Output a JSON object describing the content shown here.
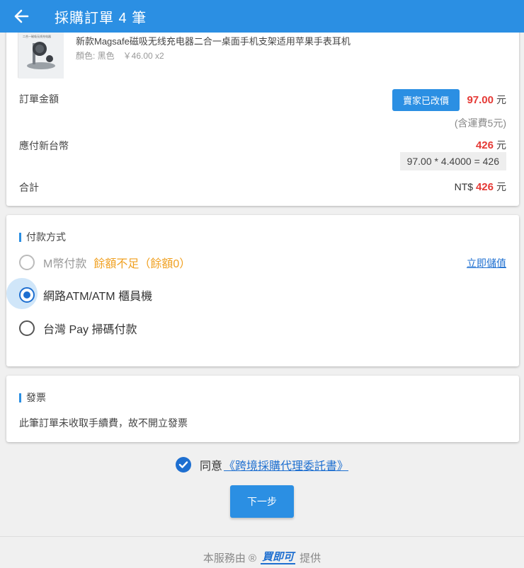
{
  "header": {
    "title": "採購訂單 4 筆"
  },
  "product": {
    "name": "新款Magsafe磁吸无线充电器二合一桌面手机支架适用苹果手表耳机",
    "meta": "顏色: 黑色　￥46.00 x2",
    "thumb_caption": "二合一磁吸无线充电器"
  },
  "order": {
    "amount_label": "訂單金額",
    "price_changed_button": "賣家已改價",
    "amount_value": "97.00",
    "currency_unit": "元",
    "shipping_note": "(含運費5元)",
    "twd_label": "應付新台幣",
    "twd_value": "426",
    "conversion": "97.00 * 4.4000 = 426",
    "total_label": "合計",
    "total_prefix": "NT$",
    "total_value": "426"
  },
  "payment": {
    "section_title": "付款方式",
    "options": [
      {
        "label": "M幣付款",
        "note": "餘額不足（餘額0）",
        "state": "disabled"
      },
      {
        "label": "網路ATM/ATM 櫃員機",
        "state": "selected"
      },
      {
        "label": "台灣 Pay 掃碼付款",
        "state": "unselected"
      }
    ],
    "topup_link": "立即儲值"
  },
  "invoice": {
    "section_title": "發票",
    "text": "此筆訂單未收取手續費，故不開立發票"
  },
  "agreement": {
    "prefix": "同意",
    "link": "《跨境採購代理委託書》",
    "checked": true
  },
  "next_button": "下一步",
  "footer": {
    "prefix": "本服務由 ®",
    "logo_text": "買即可",
    "suffix": "提供"
  },
  "colors": {
    "primary": "#2b8fe3",
    "price_red": "#e53935",
    "warning": "#f0a020",
    "link": "#1e6fd0"
  }
}
